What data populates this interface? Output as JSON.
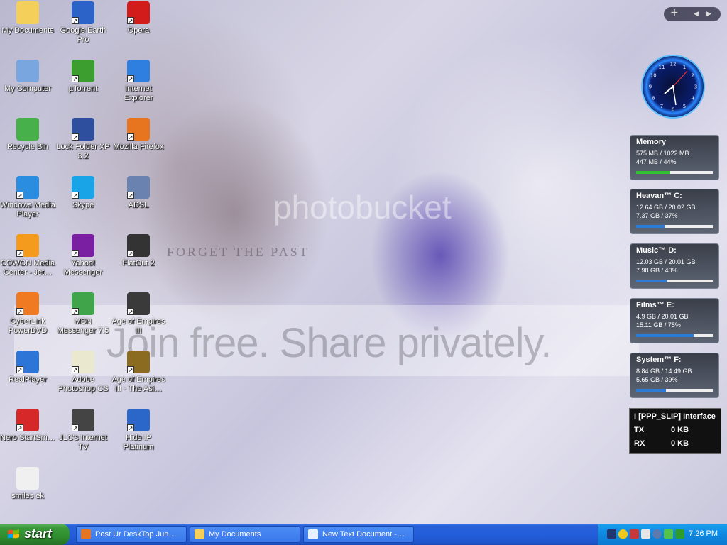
{
  "desktop": {
    "icons": [
      {
        "label": "My Documents",
        "icon": "folder-documents-icon",
        "shortcut": false
      },
      {
        "label": "Google Earth Pro",
        "icon": "google-earth-icon",
        "shortcut": true
      },
      {
        "label": "Opera",
        "icon": "opera-icon",
        "shortcut": true
      },
      {
        "label": "My Computer",
        "icon": "computer-icon",
        "shortcut": false
      },
      {
        "label": "µTorrent",
        "icon": "utorrent-icon",
        "shortcut": true
      },
      {
        "label": "Internet Explorer",
        "icon": "internet-explorer-icon",
        "shortcut": true
      },
      {
        "label": "Recycle Bin",
        "icon": "recycle-bin-icon",
        "shortcut": false
      },
      {
        "label": "Lock Folder XP 3.2",
        "icon": "lock-folder-icon",
        "shortcut": true
      },
      {
        "label": "Mozilla Firefox",
        "icon": "firefox-icon",
        "shortcut": true
      },
      {
        "label": "Windows Media Player",
        "icon": "windows-media-player-icon",
        "shortcut": true
      },
      {
        "label": "Skype",
        "icon": "skype-icon",
        "shortcut": true
      },
      {
        "label": "ADSL",
        "icon": "network-connection-icon",
        "shortcut": true
      },
      {
        "label": "COWON Media Center - Jet…",
        "icon": "cowon-media-icon",
        "shortcut": true
      },
      {
        "label": "Yahoo! Messenger",
        "icon": "yahoo-messenger-icon",
        "shortcut": true
      },
      {
        "label": "FlatOut 2",
        "icon": "flatout-icon",
        "shortcut": true
      },
      {
        "label": "CyberLink PowerDVD",
        "icon": "powerdvd-icon",
        "shortcut": true
      },
      {
        "label": "MSN Messenger 7.5",
        "icon": "msn-messenger-icon",
        "shortcut": true
      },
      {
        "label": "Age of Empires III",
        "icon": "age-of-empires-icon",
        "shortcut": true
      },
      {
        "label": "RealPlayer",
        "icon": "realplayer-icon",
        "shortcut": true
      },
      {
        "label": "Adobe Photoshop CS",
        "icon": "photoshop-icon",
        "shortcut": true
      },
      {
        "label": "Age of Empires III - The Asi…",
        "icon": "age-of-empires-asian-icon",
        "shortcut": true
      },
      {
        "label": "Nero StartSm…",
        "icon": "nero-icon",
        "shortcut": true
      },
      {
        "label": "JLC's Internet TV",
        "icon": "internet-tv-icon",
        "shortcut": true
      },
      {
        "label": "Hide IP Platinum",
        "icon": "hide-ip-icon",
        "shortcut": true
      },
      {
        "label": "smiles ek",
        "icon": "image-file-icon",
        "shortcut": false
      }
    ],
    "wallpaper_text": {
      "join": "Join free. Share privately.",
      "photobucket": "photobucket",
      "forget": "FORGET THE PAST"
    }
  },
  "gadgets": {
    "memory": {
      "title": "Memory",
      "line1": "575 MB / 1022 MB",
      "line2": "447 MB / 44%",
      "percent": 44,
      "color": "#33c233"
    },
    "drives": [
      {
        "title": "Heavan™ C:",
        "line1": "12.64 GB / 20.02 GB",
        "line2": "7.37 GB / 37%",
        "percent": 37,
        "color": "#2e7bd6"
      },
      {
        "title": "Music™ D:",
        "line1": "12.03 GB / 20.01 GB",
        "line2": "7.98 GB / 40%",
        "percent": 40,
        "color": "#2e7bd6"
      },
      {
        "title": "Films™ E:",
        "line1": "4.9 GB / 20.01 GB",
        "line2": "15.11 GB / 75%",
        "percent": 75,
        "color": "#2e7bd6"
      },
      {
        "title": "System™ F:",
        "line1": "8.84 GB / 14.49 GB",
        "line2": "5.65 GB / 39%",
        "percent": 39,
        "color": "#2e7bd6"
      }
    ],
    "network": {
      "title": "I [PPP_SLIP] Interface",
      "tx_label": "TX",
      "tx_value": "0 KB",
      "rx_label": "RX",
      "rx_value": "0 KB"
    },
    "sidebar_controls": {
      "add": "+",
      "prev": "◀",
      "next": "▶"
    },
    "clock_numbers": [
      "12",
      "1",
      "2",
      "3",
      "4",
      "5",
      "6",
      "7",
      "8",
      "9",
      "10",
      "11"
    ]
  },
  "taskbar": {
    "start_label": "start",
    "tasks": [
      {
        "label": "Post Ur DeskTop Jun…",
        "icon": "firefox-icon"
      },
      {
        "label": "My Documents",
        "icon": "folder-icon"
      },
      {
        "label": "New Text Document -…",
        "icon": "notepad-icon"
      }
    ],
    "time": "7:26 PM"
  },
  "colors": {
    "taskbar": "#245edb",
    "start": "#3a9a3a",
    "tray": "#0f88e0"
  }
}
